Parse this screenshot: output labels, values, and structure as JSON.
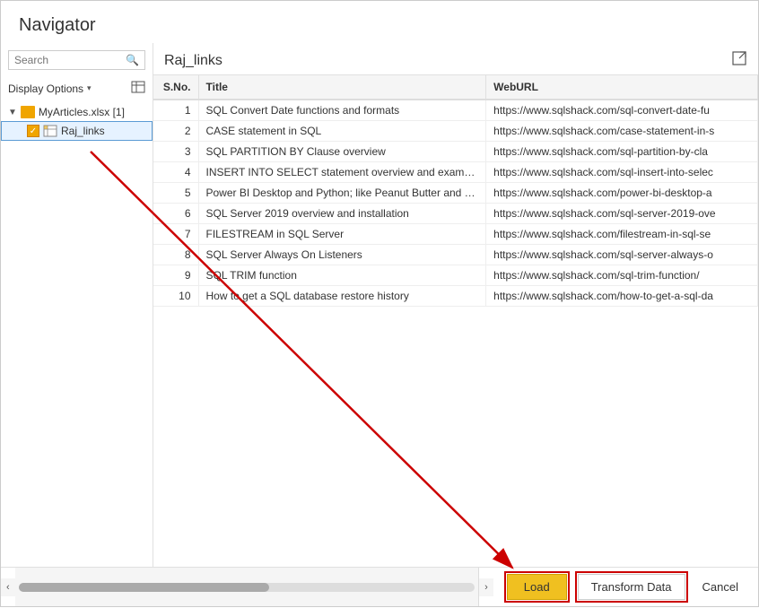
{
  "dialog": {
    "title": "Navigator"
  },
  "left_panel": {
    "search_placeholder": "Search",
    "display_options_label": "Display Options",
    "tree": {
      "root_label": "MyArticles.xlsx [1]",
      "child_label": "Raj_links"
    }
  },
  "right_panel": {
    "preview_title": "Raj_links",
    "table": {
      "columns": [
        "S.No.",
        "Title",
        "WebURL"
      ],
      "rows": [
        {
          "sno": "1",
          "title": "SQL Convert Date functions and formats",
          "url": "https://www.sqlshack.com/sql-convert-date-fu"
        },
        {
          "sno": "2",
          "title": "CASE statement in SQL",
          "url": "https://www.sqlshack.com/case-statement-in-s"
        },
        {
          "sno": "3",
          "title": "SQL PARTITION BY Clause overview",
          "url": "https://www.sqlshack.com/sql-partition-by-cla"
        },
        {
          "sno": "4",
          "title": "INSERT INTO SELECT statement overview and examples",
          "url": "https://www.sqlshack.com/sql-insert-into-selec"
        },
        {
          "sno": "5",
          "title": "Power BI Desktop and Python; like Peanut Butter and Chocolate",
          "url": "https://www.sqlshack.com/power-bi-desktop-a"
        },
        {
          "sno": "6",
          "title": "SQL Server 2019 overview and installation",
          "url": "https://www.sqlshack.com/sql-server-2019-ove"
        },
        {
          "sno": "7",
          "title": "FILESTREAM in SQL Server",
          "url": "https://www.sqlshack.com/filestream-in-sql-se"
        },
        {
          "sno": "8",
          "title": "SQL Server Always On Listeners",
          "url": "https://www.sqlshack.com/sql-server-always-o"
        },
        {
          "sno": "9",
          "title": "SQL TRIM function",
          "url": "https://www.sqlshack.com/sql-trim-function/"
        },
        {
          "sno": "10",
          "title": "How to get a SQL database restore history",
          "url": "https://www.sqlshack.com/how-to-get-a-sql-da"
        }
      ]
    }
  },
  "footer": {
    "load_label": "Load",
    "transform_label": "Transform Data",
    "cancel_label": "Cancel"
  }
}
